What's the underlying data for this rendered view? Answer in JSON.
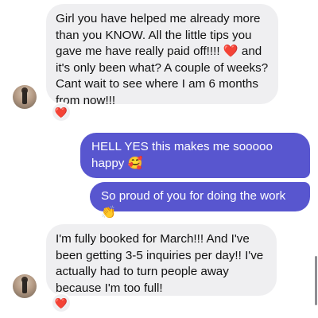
{
  "messages": [
    {
      "sender": "them",
      "text": "Girl you have helped me already more than you KNOW. All the little tips you gave me have really paid off!!!! ❤️ and it's only been what? A couple of weeks? Cant wait to see where I am 6 months from now!!!",
      "reaction": "❤️"
    },
    {
      "sender": "me",
      "text": "HELL YES this makes me sooooo happy 🥰"
    },
    {
      "sender": "me",
      "text": "So proud of you for doing the work 👏"
    },
    {
      "sender": "them",
      "text": "I'm fully booked for March!!! And I've been getting 3-5 inquiries per day!! I've actually had to turn people away because I'm too full!",
      "reaction": "❤️"
    }
  ],
  "icons": {
    "avatar": "contact-avatar-photo",
    "reaction": "heart-reaction-icon"
  },
  "colors": {
    "incoming_bubble": "#efeff1",
    "outgoing_bubble": "#5856cf",
    "heart": "#e0242e"
  }
}
